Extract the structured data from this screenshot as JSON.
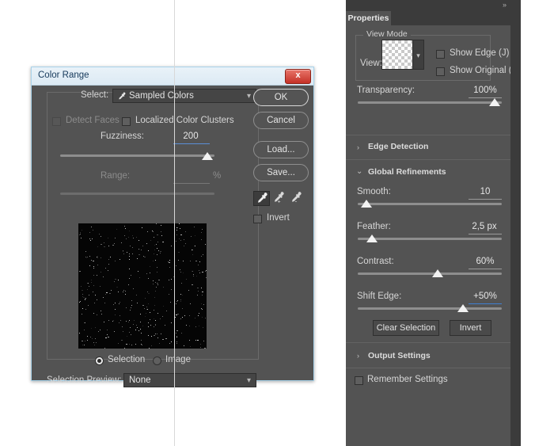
{
  "dialog": {
    "title": "Color Range",
    "close_label": "x",
    "select_label": "Select:",
    "select_value": "Sampled Colors",
    "detect_faces_label": "Detect Faces",
    "localized_clusters_label": "Localized Color Clusters",
    "fuzziness_label": "Fuzziness:",
    "fuzziness_value": "200",
    "range_label": "Range:",
    "range_value": "",
    "range_unit": "%",
    "buttons": {
      "ok": "OK",
      "cancel": "Cancel",
      "load": "Load...",
      "save": "Save..."
    },
    "eyedroppers": [
      {
        "name": "eyedropper-icon",
        "modifier": "",
        "selected": true
      },
      {
        "name": "eyedropper-add-icon",
        "modifier": "+",
        "selected": false
      },
      {
        "name": "eyedropper-subtract-icon",
        "modifier": "-",
        "selected": false
      }
    ],
    "invert_label": "Invert",
    "preview_mode_selection": "Selection",
    "preview_mode_image": "Image",
    "selection_preview_label": "Selection Preview:",
    "selection_preview_value": "None"
  },
  "panel": {
    "collapse_arrows": "»",
    "tab_label": "Properties",
    "view_mode": {
      "legend": "View Mode",
      "view_label": "View:",
      "show_edge_label": "Show Edge (J)",
      "show_original_label": "Show Original (P)"
    },
    "transparency": {
      "label": "Transparency:",
      "value": "100%"
    },
    "edge_detection": {
      "label": "Edge Detection",
      "triangle": "›"
    },
    "global_refinements": {
      "label": "Global Refinements",
      "triangle": "⌄",
      "sliders": [
        {
          "label": "Smooth:",
          "value": "10",
          "percent": 10,
          "accent": false
        },
        {
          "label": "Feather:",
          "value": "2,5 px",
          "percent": 14,
          "accent": false
        },
        {
          "label": "Contrast:",
          "value": "60%",
          "percent": 60,
          "accent": false
        },
        {
          "label": "Shift Edge:",
          "value": "+50%",
          "percent": 75,
          "accent": true
        }
      ]
    },
    "clear_selection_label": "Clear Selection",
    "invert_label": "Invert",
    "output_settings": {
      "label": "Output Settings",
      "triangle": "›"
    },
    "remember_settings_label": "Remember Settings"
  },
  "colors": {
    "panel_bg": "#535353",
    "accent_blue": "#3f7fd0",
    "title_bar": "#e9f2f8",
    "close_red": "#c53127"
  }
}
